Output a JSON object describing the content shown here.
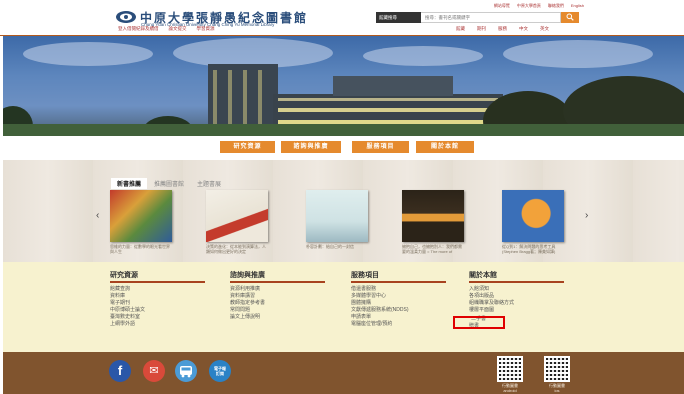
{
  "header": {
    "title_zh": "中原大學張靜愚紀念圖書館",
    "title_en": "Chung Yuan Christian University Chang Ching Yu Memorial Library",
    "top_links": [
      "網站導覽",
      "中原大學首頁",
      "聯絡我們",
      "English"
    ],
    "search_scope": "館藏搜尋",
    "search_placeholder": "搜尋：書刊名或關鍵字",
    "search_button": "Q",
    "subnav_left": [
      "登入借閱紀錄及續借",
      "論文提交",
      "學習資源"
    ],
    "subnav_right": [
      "館藏",
      "期刊",
      "服務",
      "中文",
      "英文"
    ]
  },
  "tabs": [
    "研究資源",
    "諮詢與推廣",
    "服務項目",
    "關於本館"
  ],
  "shelf": {
    "tabs": [
      "新書推薦",
      "推薦圖書館",
      "主題書展"
    ],
    "prev": "‹",
    "next": "›",
    "books": [
      {
        "caption": "思維的力量：從數學的眼光看世界與人生"
      },
      {
        "caption": "決策的進化：從本能到演算法，人類如何做出更好的決定"
      },
      {
        "caption": "朴容計劃：給自己的一封信"
      },
      {
        "caption": "擁抱自己，也擁抱別人：我們都需要的溫柔力量 = The more of"
      },
      {
        "caption": "從Q到1：解決問題的思考工具 (Stephen Bragg著；陳美如譯)"
      }
    ],
    "book_colors": [
      "#c23a2b",
      "#e8e3d8",
      "#cfe2e4",
      "#2b2318",
      "#3a6fb8"
    ]
  },
  "footer_columns": [
    {
      "heading": "研究資源",
      "items": [
        "館藏查詢",
        "資料庫",
        "電子期刊",
        "中原博碩士論文",
        "臺灣數史料室",
        "上網學外語"
      ]
    },
    {
      "heading": "諮詢與推廣",
      "items": [
        "資源利用推廣",
        "資料庫講習",
        "教師指定參考書",
        "常問問題",
        "論文上傳說明"
      ]
    },
    {
      "heading": "服務項目",
      "items": [
        "借還書服務",
        "多媒體學習中心",
        "團體擁購",
        "文獻傳遞服務系統(NDDS)",
        "申請表單",
        "電腦座位管理/預約"
      ]
    },
    {
      "heading": "關於本館",
      "items": [
        "入館須知",
        "各項出版品",
        "組織職掌及聯絡方式",
        "樓層平面圖",
        "二手書",
        "贈書"
      ]
    }
  ],
  "bottom": {
    "social": [
      {
        "label": "f"
      },
      {
        "label": "✉"
      },
      {
        "label": "🚌"
      },
      {
        "label": "電子報\n訂閱"
      }
    ],
    "qr_captions": [
      "行動圖書\nandroid",
      "行動圖書\nios"
    ]
  }
}
